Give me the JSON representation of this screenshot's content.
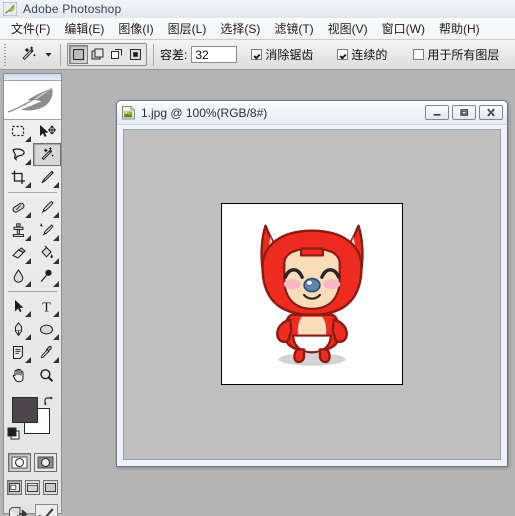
{
  "window": {
    "app_title": "Adobe Photoshop",
    "app_icon": "photoshop-feather-icon"
  },
  "menubar": {
    "items": [
      {
        "label": "文件(F)",
        "name": "menu-file"
      },
      {
        "label": "编辑(E)",
        "name": "menu-edit"
      },
      {
        "label": "图像(I)",
        "name": "menu-image"
      },
      {
        "label": "图层(L)",
        "name": "menu-layer"
      },
      {
        "label": "选择(S)",
        "name": "menu-select"
      },
      {
        "label": "滤镜(T)",
        "name": "menu-filter"
      },
      {
        "label": "视图(V)",
        "name": "menu-view"
      },
      {
        "label": "窗口(W)",
        "name": "menu-window"
      },
      {
        "label": "帮助(H)",
        "name": "menu-help"
      }
    ]
  },
  "options_bar": {
    "active_tool_icon": "magic-wand-icon",
    "selection_modes": [
      {
        "name": "new-selection",
        "active": true
      },
      {
        "name": "add-to-selection",
        "active": false
      },
      {
        "name": "subtract-from-selection",
        "active": false
      },
      {
        "name": "intersect-with-selection",
        "active": false
      }
    ],
    "tolerance_label": "容差:",
    "tolerance_value": "32",
    "checkboxes": [
      {
        "label": "消除锯齿",
        "checked": true,
        "name": "anti-alias"
      },
      {
        "label": "连续的",
        "checked": true,
        "name": "contiguous"
      },
      {
        "label": "用于所有图层",
        "checked": false,
        "name": "sample-all-layers"
      }
    ]
  },
  "toolbox": {
    "logo_icon": "photoshop-feather-logo",
    "tools": [
      [
        {
          "name": "rectangular-marquee-tool",
          "selected": false
        },
        {
          "name": "move-tool",
          "selected": false
        }
      ],
      [
        {
          "name": "lasso-tool",
          "selected": false
        },
        {
          "name": "magic-wand-tool",
          "selected": true
        }
      ],
      [
        {
          "name": "crop-tool",
          "selected": false
        },
        {
          "name": "slice-tool",
          "selected": false
        }
      ],
      [
        {
          "name": "healing-brush-tool",
          "selected": false
        },
        {
          "name": "brush-tool",
          "selected": false
        }
      ],
      [
        {
          "name": "clone-stamp-tool",
          "selected": false
        },
        {
          "name": "history-brush-tool",
          "selected": false
        }
      ],
      [
        {
          "name": "eraser-tool",
          "selected": false
        },
        {
          "name": "paint-bucket-tool",
          "selected": false
        }
      ],
      [
        {
          "name": "blur-tool",
          "selected": false
        },
        {
          "name": "dodge-tool",
          "selected": false
        }
      ],
      [
        {
          "name": "path-selection-tool",
          "selected": false
        },
        {
          "name": "type-tool",
          "selected": false
        }
      ],
      [
        {
          "name": "pen-tool",
          "selected": false
        },
        {
          "name": "ellipse-shape-tool",
          "selected": false
        }
      ],
      [
        {
          "name": "notes-tool",
          "selected": false
        },
        {
          "name": "eyedropper-tool",
          "selected": false
        }
      ],
      [
        {
          "name": "hand-tool",
          "selected": false
        },
        {
          "name": "zoom-tool",
          "selected": false
        }
      ]
    ],
    "colors": {
      "foreground": "#4d464b",
      "background": "#ffffff",
      "swap_icon": "swap-colors-icon",
      "default_icon": "default-colors-icon"
    },
    "quick_mask": [
      {
        "name": "standard-mode-button",
        "active": true
      },
      {
        "name": "quick-mask-mode-button",
        "active": false
      }
    ],
    "screen_modes": [
      {
        "name": "standard-screen-mode-button",
        "active": true
      },
      {
        "name": "full-screen-with-menubar-button",
        "active": false
      },
      {
        "name": "full-screen-mode-button",
        "active": false
      }
    ],
    "jump_buttons": [
      {
        "name": "jump-to-imageready-button"
      },
      {
        "name": "edit-in-imageready-button"
      }
    ]
  },
  "document": {
    "title": "1.jpg @ 100%(RGB/8#)",
    "file_icon": "jpg-document-icon",
    "window_buttons": [
      {
        "name": "minimize-button",
        "glyph": "—"
      },
      {
        "name": "restore-button",
        "glyph": "❐"
      },
      {
        "name": "close-button",
        "glyph": "✕"
      }
    ],
    "canvas": {
      "background_color": "#bfbfbf",
      "image_name": "ali-fox-cartoon-image",
      "image_background": "#ffffff",
      "colors": {
        "fur_red": "#ee2b20",
        "face_cream": "#fbddbb",
        "nose_blue": "#5f86a8",
        "blush_pink": "#f7b9c4",
        "outline": "#7a1510",
        "shadow": "#cfcfcf"
      }
    }
  }
}
